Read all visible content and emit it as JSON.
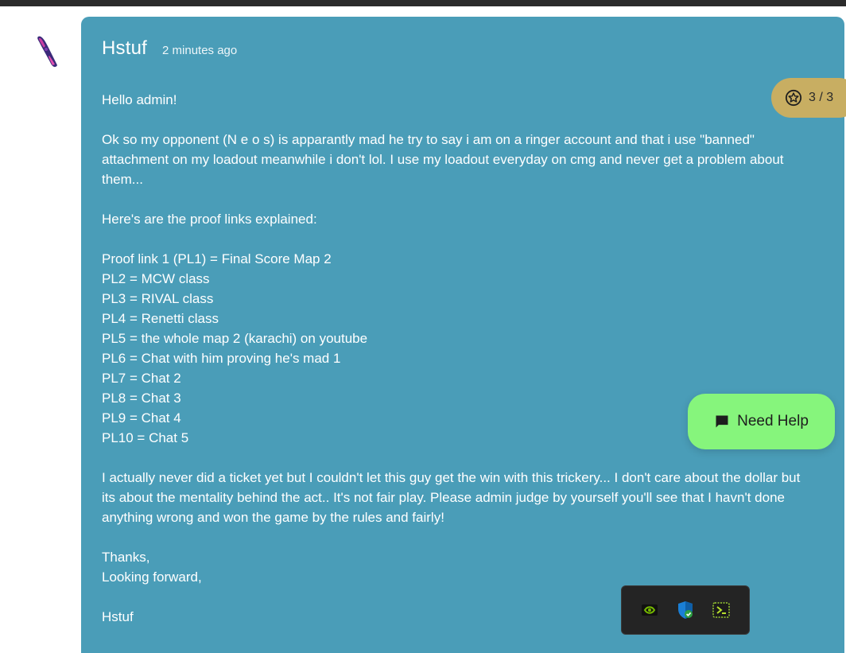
{
  "message": {
    "author": "Hstuf",
    "timestamp": "2 minutes ago",
    "lines": [
      "Hello admin!",
      "",
      "Ok so my opponent (N e o s) is apparantly mad he try to say i am on a ringer account and that i use \"banned\"",
      "attachment on my loadout meanwhile i don't lol. I use my loadout everyday on cmg and never get a problem about",
      "them...",
      "",
      "Here's are the proof links explained:",
      "",
      "Proof link 1 (PL1) = Final Score Map 2",
      "PL2 = MCW class",
      "PL3 = RIVAL class",
      "PL4 = Renetti class",
      "PL5 = the whole map 2 (karachi) on youtube",
      "PL6 = Chat with him proving he's mad 1",
      "PL7 = Chat 2",
      "PL8 = Chat 3",
      "PL9 = Chat 4",
      "PL10 = Chat 5",
      "",
      "I actually never did a ticket yet but I couldn't let this guy get the win with this trickery... I don't care about the dollar but",
      "its about the mentality behind the act.. It's not fair play. Please admin judge by yourself you'll see that I havn't done",
      "anything wrong and won the game by the rules and fairly!",
      "",
      "Thanks,",
      "Looking forward,",
      "",
      "Hstuf"
    ]
  },
  "reactions": {
    "label": "3 / 3",
    "icon": "star-circle-icon"
  },
  "help_button": {
    "label": "Need Help",
    "icon": "chat-bubble-icon"
  },
  "tray": {
    "icons": [
      "nvidia-icon",
      "security-shield-icon",
      "terminal-app-icon"
    ]
  },
  "colors": {
    "card": "#4a9db8",
    "badge": "#c8ae62",
    "help_button": "#86f57c",
    "tray": "#242424"
  }
}
